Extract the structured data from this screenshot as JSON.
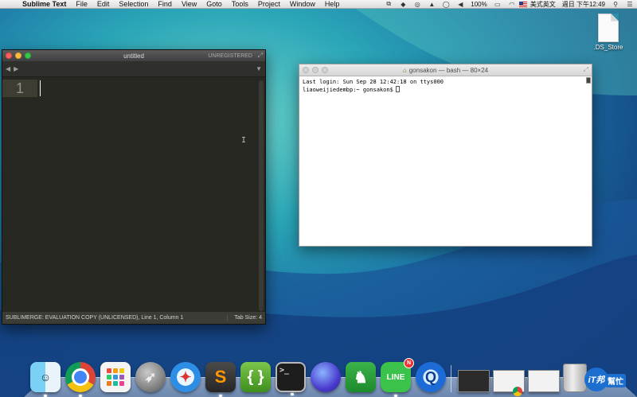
{
  "menubar": {
    "app_name": "Sublime Text",
    "menus": [
      "File",
      "Edit",
      "Selection",
      "Find",
      "View",
      "Goto",
      "Tools",
      "Project",
      "Window",
      "Help"
    ],
    "battery": "100%",
    "input_source": "美式英文",
    "clock": "週日 下午12:49"
  },
  "desktop": {
    "file_name": ".DS_Store"
  },
  "sublime": {
    "title": "untitled",
    "registration": "UNREGISTERED",
    "line_number": "1",
    "status_left": "SUBLIMERGE: EVALUATION COPY (UNLICENSED), Line 1, Column 1",
    "status_right": "Tab Size: 4"
  },
  "terminal": {
    "title": "gonsakon — bash — 80×24",
    "lines": [
      "Last login: Sun Sep 28 12:42:18 on ttys000",
      "liaoweijiedembp:~ gonsakon$"
    ]
  },
  "dock": {
    "apps": [
      "finder",
      "chrome",
      "launchpad",
      "rocket",
      "safari",
      "sublime-text",
      "brackets",
      "terminal",
      "siri",
      "evernote",
      "line",
      "quicktime"
    ],
    "line_badge": "N",
    "terminal_glyph": ">_",
    "sublime_glyph": "S",
    "brackets_glyph": "{ }",
    "line_label": "LINE"
  },
  "watermark": {
    "logo": "iT邦",
    "text": "幫忙"
  }
}
